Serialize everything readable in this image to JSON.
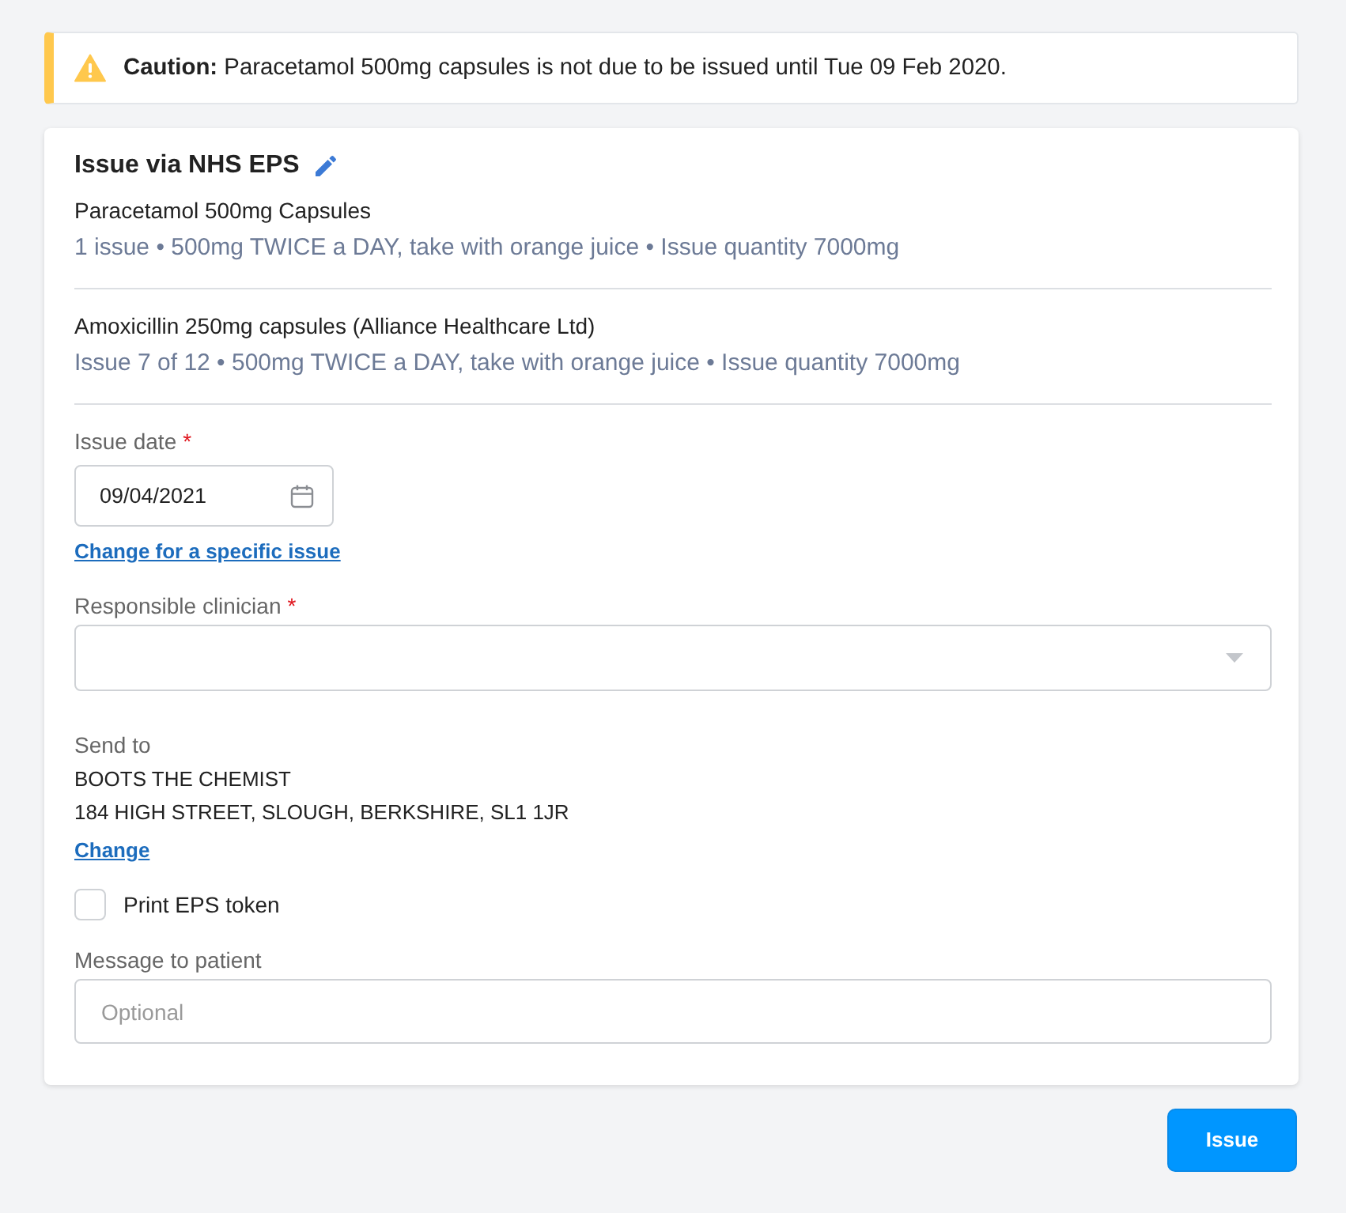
{
  "alert": {
    "kind": "caution",
    "message": "**Caution:** Paracetamol 500mg capsules is not due to be issued until Tue 09 Feb 2020."
  },
  "card": {
    "title": "Issue via NHS EPS",
    "medications": [
      {
        "name": "Paracetamol 500mg Capsules",
        "details": "1 issue • 500mg TWICE a DAY, take with orange juice • Issue quantity 7000mg"
      },
      {
        "name": "Amoxicillin 250mg capsules (Alliance Healthcare Ltd)",
        "details": "Issue 7 of 12 • 500mg TWICE a DAY, take with orange juice • Issue quantity 7000mg"
      }
    ],
    "issue_date": {
      "label": "Issue date",
      "required_mark": "*",
      "value": "09/04/2021",
      "link": "Change for a specific issue"
    },
    "responsible_clinician": {
      "label": "Responsible clinician",
      "required_mark": "*"
    },
    "send_to": {
      "label": "Send to",
      "name": "BOOTS THE CHEMIST",
      "address": "184 HIGH STREET, SLOUGH, BERKSHIRE, SL1 1JR",
      "link": "Change"
    },
    "print_eps_token": {
      "label": "Print EPS token",
      "checked": false
    },
    "message_to_patient": {
      "label": "Message to patient",
      "placeholder": "Optional"
    }
  },
  "buttons": [
    {
      "label": "Issue"
    }
  ]
}
